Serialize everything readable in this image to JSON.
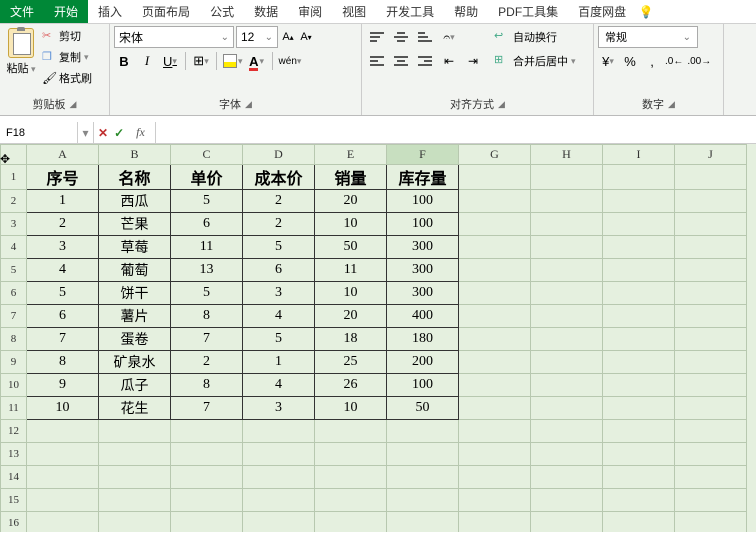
{
  "menu": {
    "file": "文件",
    "start": "开始",
    "insert": "插入",
    "layout": "页面布局",
    "formula": "公式",
    "data": "数据",
    "review": "审阅",
    "view": "视图",
    "dev": "开发工具",
    "help": "帮助",
    "pdf": "PDF工具集",
    "baidu": "百度网盘"
  },
  "ribbon": {
    "paste": "粘贴",
    "cut": "剪切",
    "copy": "复制",
    "brush": "格式刷",
    "clipboard": "剪贴板",
    "fontname": "宋体",
    "fontsize": "12",
    "fontgrp": "字体",
    "aligngrp": "对齐方式",
    "wrap": "自动换行",
    "merge": "合并后居中",
    "numformat": "常规",
    "numgrp": "数字"
  },
  "namebox": "F18",
  "cols": [
    "A",
    "B",
    "C",
    "D",
    "E",
    "F",
    "G",
    "H",
    "I",
    "J"
  ],
  "headers": [
    "序号",
    "名称",
    "单价",
    "成本价",
    "销量",
    "库存量"
  ],
  "rows": [
    [
      "1",
      "西瓜",
      "5",
      "2",
      "20",
      "100"
    ],
    [
      "2",
      "芒果",
      "6",
      "2",
      "10",
      "100"
    ],
    [
      "3",
      "草莓",
      "11",
      "5",
      "50",
      "300"
    ],
    [
      "4",
      "葡萄",
      "13",
      "6",
      "11",
      "300"
    ],
    [
      "5",
      "饼干",
      "5",
      "3",
      "10",
      "300"
    ],
    [
      "6",
      "薯片",
      "8",
      "4",
      "20",
      "400"
    ],
    [
      "7",
      "蛋卷",
      "7",
      "5",
      "18",
      "180"
    ],
    [
      "8",
      "矿泉水",
      "2",
      "1",
      "25",
      "200"
    ],
    [
      "9",
      "瓜子",
      "8",
      "4",
      "26",
      "100"
    ],
    [
      "10",
      "花生",
      "7",
      "3",
      "10",
      "50"
    ]
  ]
}
